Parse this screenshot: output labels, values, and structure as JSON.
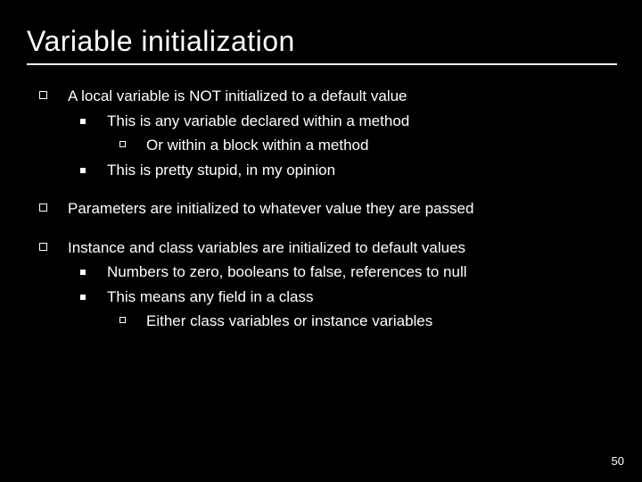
{
  "slide": {
    "title": "Variable initialization",
    "page_number": "50",
    "bullets": [
      {
        "text": "A local variable is NOT initialized to a default value",
        "children": [
          {
            "text": "This is any variable declared within a method",
            "children": [
              {
                "text": "Or within a block within a method"
              }
            ]
          },
          {
            "text": "This is pretty stupid, in my opinion"
          }
        ]
      },
      {
        "text": "Parameters are initialized to whatever value they are passed"
      },
      {
        "text": "Instance and class variables are initialized to default values",
        "children": [
          {
            "text": "Numbers to zero, booleans to false, references to null"
          },
          {
            "text": "This means any field in a class",
            "children": [
              {
                "text": "Either class variables or instance variables"
              }
            ]
          }
        ]
      }
    ]
  }
}
